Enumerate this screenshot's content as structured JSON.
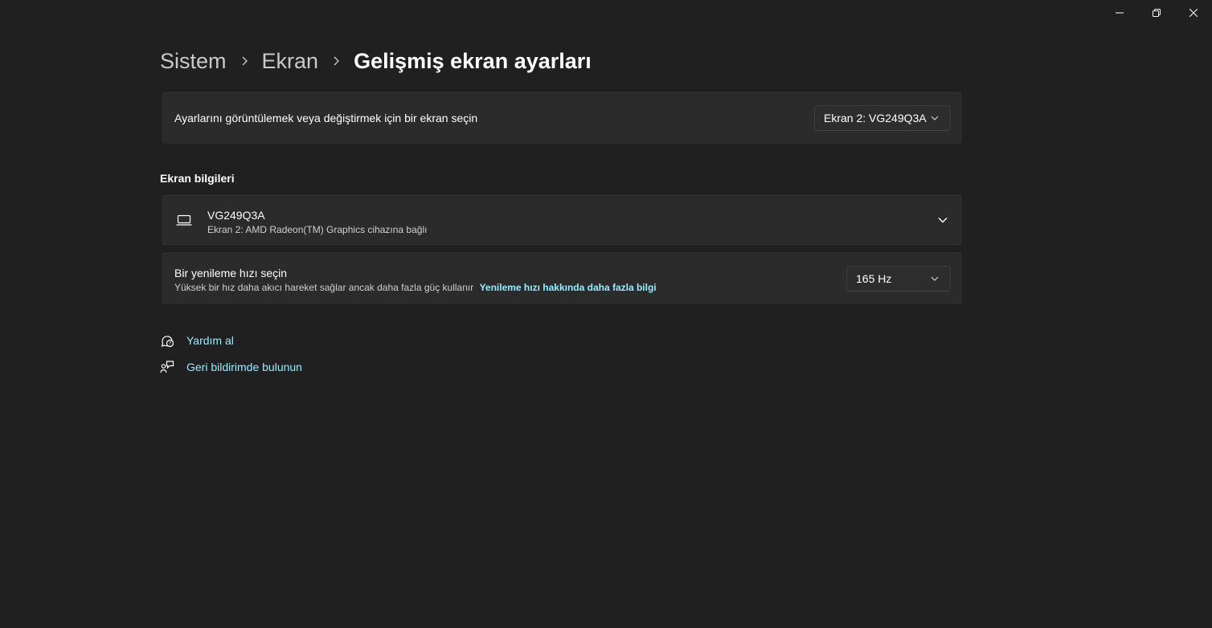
{
  "window": {
    "controls": [
      "minimize",
      "restore",
      "close"
    ]
  },
  "breadcrumb": {
    "items": [
      "Sistem",
      "Ekran"
    ],
    "current": "Gelişmiş ekran ayarları"
  },
  "display_select": {
    "label": "Ayarlarını görüntülemek veya değiştirmek için bir ekran seçin",
    "selected": "Ekran 2: VG249Q3A"
  },
  "display_info": {
    "heading": "Ekran bilgileri",
    "name": "VG249Q3A",
    "description": "Ekran 2: AMD Radeon(TM) Graphics cihazına bağlı",
    "icon": "laptop-icon"
  },
  "refresh_rate": {
    "title": "Bir yenileme hızı seçin",
    "description": "Yüksek bir hız daha akıcı hareket sağlar ancak daha fazla güç kullanır",
    "link": "Yenileme hızı hakkında daha fazla bilgi",
    "selected": "165 Hz"
  },
  "help": {
    "get_help": "Yardım al",
    "feedback": "Geri bildirimde bulunun"
  },
  "colors": {
    "background": "#202020",
    "card": "#2b2b2b",
    "accent_link": "#99ebff"
  }
}
